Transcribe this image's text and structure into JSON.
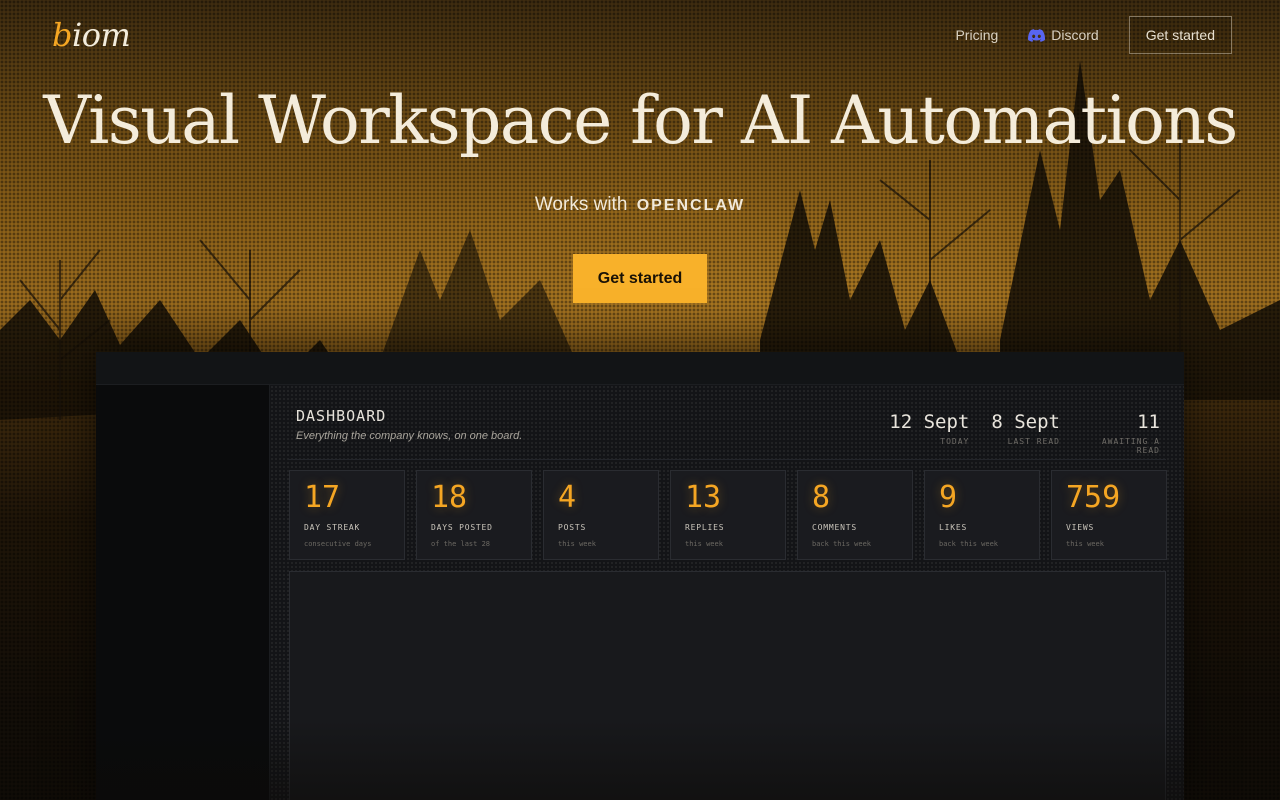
{
  "logo": {
    "first": "b",
    "rest": "iom"
  },
  "nav": {
    "pricing": "Pricing",
    "discord": "Discord",
    "cta": "Get started"
  },
  "hero": {
    "title": "Visual Workspace for AI Automations",
    "works_with": "Works with",
    "brand": "OPENCLAW",
    "cta": "Get started"
  },
  "colors": {
    "accent": "#f8b12a",
    "discord": "#5865f2",
    "stat_number": "#f5a623"
  },
  "dashboard": {
    "title": "DASHBOARD",
    "subtitle": "Everything the company knows, on one board.",
    "header_stats": [
      {
        "value": "12 Sept",
        "label": "TODAY"
      },
      {
        "value": "8 Sept",
        "label": "LAST READ"
      },
      {
        "value": "11",
        "label": "AWAITING A READ"
      }
    ],
    "cards": [
      {
        "value": "17",
        "label": "DAY STREAK",
        "sub": "consecutive days"
      },
      {
        "value": "18",
        "label": "DAYS POSTED",
        "sub": "of the last 28"
      },
      {
        "value": "4",
        "label": "POSTS",
        "sub": "this week"
      },
      {
        "value": "13",
        "label": "REPLIES",
        "sub": "this week"
      },
      {
        "value": "8",
        "label": "COMMENTS",
        "sub": "back this week"
      },
      {
        "value": "9",
        "label": "LIKES",
        "sub": "back this week"
      },
      {
        "value": "759",
        "label": "VIEWS",
        "sub": "this week"
      }
    ]
  }
}
